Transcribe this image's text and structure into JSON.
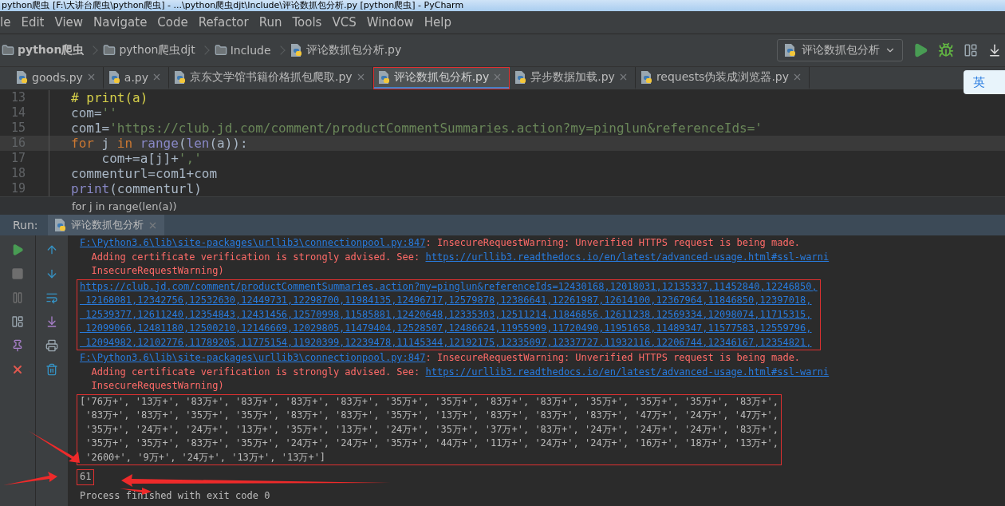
{
  "window_title": "python爬虫 [F:\\大讲台爬虫\\python爬虫] - ...\\python爬虫djt\\Include\\评论数抓包分析.py [python爬虫] - PyCharm",
  "menu": [
    "le",
    "Edit",
    "View",
    "Navigate",
    "Code",
    "Refactor",
    "Run",
    "Tools",
    "VCS",
    "Window",
    "Help"
  ],
  "breadcrumbs": [
    {
      "kind": "project",
      "label": "python爬虫"
    },
    {
      "kind": "folder",
      "label": "python爬虫djt"
    },
    {
      "kind": "folder",
      "label": "Include"
    },
    {
      "kind": "file",
      "label": "评论数抓包分析.py"
    }
  ],
  "run_config": {
    "label": "评论数抓包分析"
  },
  "editor_tabs": [
    {
      "label": "goods.py",
      "selected": false,
      "annotated": false
    },
    {
      "label": "a.py",
      "selected": false,
      "annotated": false
    },
    {
      "label": "京东文学馆书籍价格抓包爬取.py",
      "selected": false,
      "annotated": false
    },
    {
      "label": "评论数抓包分析.py",
      "selected": true,
      "annotated": true
    },
    {
      "label": "异步数据加载.py",
      "selected": false,
      "annotated": false
    },
    {
      "label": "requests伪装成浏览器.py",
      "selected": false,
      "annotated": false
    }
  ],
  "ime_indicator": "英",
  "code_lines": [
    {
      "number": "13",
      "current": false,
      "segments": [
        {
          "kind": "comment",
          "text": "# print(a)"
        }
      ]
    },
    {
      "number": "14",
      "current": false,
      "segments": [
        {
          "kind": "plain",
          "text": "com="
        },
        {
          "kind": "string",
          "text": "''"
        }
      ]
    },
    {
      "number": "15",
      "current": false,
      "segments": [
        {
          "kind": "plain",
          "text": "com1="
        },
        {
          "kind": "string",
          "text": "'https://club.jd.com/comment/productCommentSummaries.action?my=pinglun&referenceIds='"
        }
      ]
    },
    {
      "number": "16",
      "current": true,
      "segments": [
        {
          "kind": "keyword",
          "text": "for"
        },
        {
          "kind": "plain",
          "text": " j "
        },
        {
          "kind": "keyword",
          "text": "in"
        },
        {
          "kind": "builtin",
          "text": " range"
        },
        {
          "kind": "plain",
          "text": "("
        },
        {
          "kind": "builtin",
          "text": "len"
        },
        {
          "kind": "plain",
          "text": "(a)):"
        }
      ]
    },
    {
      "number": "17",
      "current": false,
      "segments": [
        {
          "kind": "plain",
          "text": "    com+=a[j]+"
        },
        {
          "kind": "string",
          "text": "','"
        }
      ]
    },
    {
      "number": "18",
      "current": false,
      "segments": [
        {
          "kind": "plain",
          "text": "commenturl=com1+com"
        }
      ]
    },
    {
      "number": "19",
      "current": false,
      "segments": [
        {
          "kind": "builtin",
          "text": "print"
        },
        {
          "kind": "plain",
          "text": "(commenturl)"
        }
      ]
    }
  ],
  "code_breadcrumb": "for j in range(len(a))",
  "run_panel": {
    "label": "Run:",
    "tab": "评论数抓包分析"
  },
  "output_blocks": [
    {
      "annotated": false,
      "lines": [
        [
          {
            "kind": "link",
            "text": "F:\\Python3.6\\lib\\site-packages\\urllib3\\connectionpool.py:847"
          },
          {
            "kind": "error",
            "text": ": InsecureRequestWarning: Unverified HTTPS request is being made."
          }
        ],
        [
          {
            "kind": "error",
            "text": "  Adding certificate verification is strongly advised. See: "
          },
          {
            "kind": "link",
            "text": "https://urllib3.readthedocs.io/en/latest/advanced-usage.html#ssl-warni"
          }
        ],
        [
          {
            "kind": "error",
            "text": "  InsecureRequestWarning)"
          }
        ]
      ]
    },
    {
      "annotated": true,
      "lines": [
        [
          {
            "kind": "link",
            "text": "https://club.jd.com/comment/productCommentSummaries.action?my=pinglun&referenceIds=12430168,12018031,12135337,11452840,12246850,"
          }
        ],
        [
          {
            "kind": "link",
            "text": " 12168081,12342756,12532630,12449731,12298700,11984135,12496717,12579878,12386641,12261987,12614100,12367964,11846850,12397018,"
          }
        ],
        [
          {
            "kind": "link",
            "text": " 12539377,12611240,12354843,12431456,12570998,11585881,12420648,12335303,12511214,11846856,12611238,12569334,12098074,11715315,"
          }
        ],
        [
          {
            "kind": "link",
            "text": " 12099066,12481180,12500210,12146669,12029805,11479404,12528507,12486624,11955909,11720490,11951658,11489347,11577583,12559796,"
          }
        ],
        [
          {
            "kind": "link",
            "text": " 12094982,12102776,11789205,11775154,11920399,12239478,11145344,12192175,12335097,12337727,11932116,12206744,12346167,12354821,"
          }
        ]
      ]
    },
    {
      "annotated": false,
      "lines": [
        [
          {
            "kind": "link",
            "text": "F:\\Python3.6\\lib\\site-packages\\urllib3\\connectionpool.py:847"
          },
          {
            "kind": "error",
            "text": ": InsecureRequestWarning: Unverified HTTPS request is being made."
          }
        ],
        [
          {
            "kind": "error",
            "text": "  Adding certificate verification is strongly advised. See: "
          },
          {
            "kind": "link",
            "text": "https://urllib3.readthedocs.io/en/latest/advanced-usage.html#ssl-warni"
          }
        ],
        [
          {
            "kind": "error",
            "text": "  InsecureRequestWarning)"
          }
        ]
      ]
    },
    {
      "annotated": true,
      "lines": [
        [
          {
            "kind": "plain",
            "text": "['76万+', '13万+', '83万+', '83万+', '83万+', '83万+', '35万+', '35万+', '83万+', '83万+', '35万+', '35万+', '35万+', '83万+',"
          }
        ],
        [
          {
            "kind": "plain",
            "text": " '83万+', '83万+', '35万+', '35万+', '83万+', '83万+', '35万+', '13万+', '83万+', '83万+', '83万+', '47万+', '24万+', '47万+',"
          }
        ],
        [
          {
            "kind": "plain",
            "text": " '35万+', '24万+', '24万+', '13万+', '35万+', '13万+', '24万+', '35万+', '37万+', '83万+', '24万+', '24万+', '24万+', '83万+',"
          }
        ],
        [
          {
            "kind": "plain",
            "text": " '35万+', '35万+', '83万+', '35万+', '24万+', '24万+', '35万+', '44万+', '11万+', '24万+', '24万+', '16万+', '18万+', '13万+',"
          }
        ],
        [
          {
            "kind": "plain",
            "text": " '2600+', '9万+', '24万+', '13万+', '13万+']"
          }
        ]
      ]
    },
    {
      "annotated": true,
      "lines": [
        [
          {
            "kind": "plain",
            "text": "61"
          }
        ]
      ]
    },
    {
      "annotated": false,
      "lines": [
        [
          {
            "kind": "plain",
            "text": "Process finished with exit code 0"
          }
        ]
      ]
    }
  ]
}
